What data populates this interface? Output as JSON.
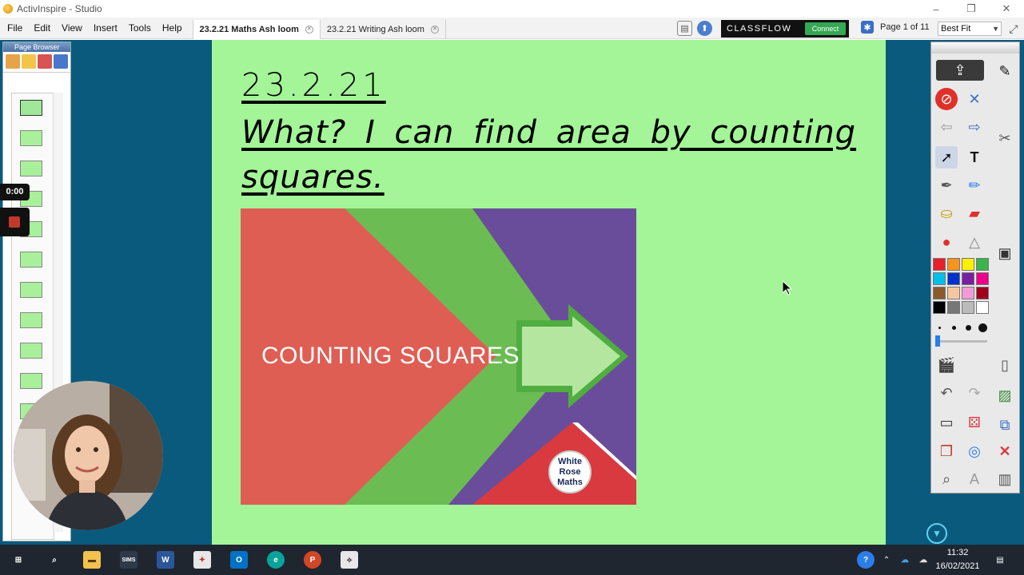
{
  "window": {
    "title": "ActivInspire - Studio",
    "controls": [
      "–",
      "❐",
      "✕"
    ]
  },
  "menu": [
    "File",
    "Edit",
    "View",
    "Insert",
    "Tools",
    "Help"
  ],
  "tabs": [
    {
      "label": "23.2.21 Maths Ash loom",
      "active": true
    },
    {
      "label": "23.2.21 Writing Ash loom",
      "active": false
    }
  ],
  "classflow": {
    "logo": "CLASSFLOW",
    "connect_label": "Connect"
  },
  "page_indicator": "Page 1 of 11",
  "zoom": {
    "value": "Best Fit"
  },
  "page_browser": {
    "title": "Page Browser",
    "thumbnail_count": 11
  },
  "recording": {
    "timer": "0:00"
  },
  "flipchart": {
    "date": "23.2.21",
    "objective": "What? I can find area by counting squares.",
    "image": {
      "label": "COUNTING SQUARES",
      "logo_lines": [
        "White",
        "Rose",
        "Maths"
      ]
    }
  },
  "palette": [
    "#e8202a",
    "#f7941d",
    "#ffef00",
    "#39b54a",
    "#00c0e8",
    "#0033cc",
    "#7a1fa2",
    "#ec008c",
    "#8b5a2b",
    "#f5c7a0",
    "#f29ad8",
    "#a0001b",
    "#000000",
    "#777777",
    "#bbbbbb",
    "#ffffff"
  ],
  "taskbar": {
    "clock_time": "11:32",
    "clock_date": "16/02/2021",
    "apps": [
      "windows-start",
      "search",
      "file-explorer",
      "sims",
      "word",
      "paint-tool",
      "outlook",
      "edge",
      "powerpoint",
      "activinspire"
    ]
  }
}
